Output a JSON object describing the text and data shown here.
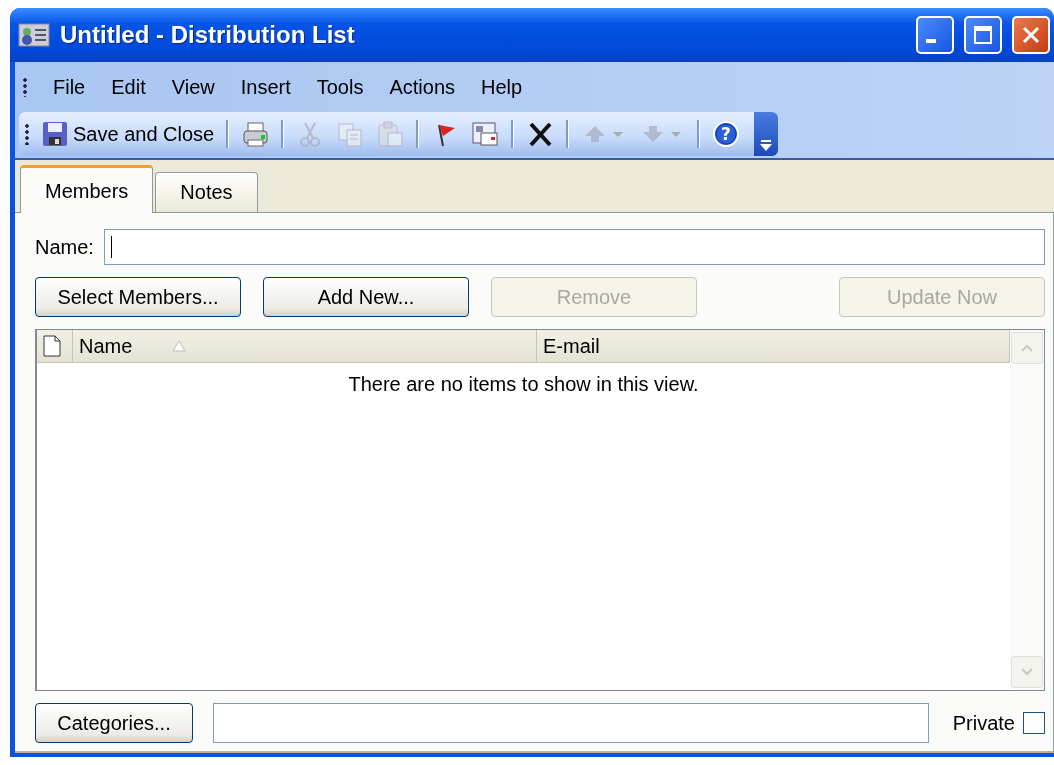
{
  "window": {
    "title": "Untitled - Distribution List"
  },
  "menu": [
    "File",
    "Edit",
    "View",
    "Insert",
    "Tools",
    "Actions",
    "Help"
  ],
  "toolbar": [
    {
      "kind": "save",
      "label": "Save and Close",
      "disabled": false
    },
    {
      "kind": "separator"
    },
    {
      "kind": "print",
      "disabled": false
    },
    {
      "kind": "separator"
    },
    {
      "kind": "cut",
      "disabled": true
    },
    {
      "kind": "copy",
      "disabled": true
    },
    {
      "kind": "paste",
      "disabled": true
    },
    {
      "kind": "separator"
    },
    {
      "kind": "flag",
      "disabled": false
    },
    {
      "kind": "address",
      "disabled": false
    },
    {
      "kind": "separator"
    },
    {
      "kind": "delete",
      "disabled": false
    },
    {
      "kind": "separator"
    },
    {
      "kind": "up",
      "disabled": true
    },
    {
      "kind": "down",
      "disabled": true
    },
    {
      "kind": "separator"
    },
    {
      "kind": "help",
      "glyph": "?",
      "disabled": false
    }
  ],
  "tabs": [
    {
      "label": "Members",
      "selected": true
    },
    {
      "label": "Notes",
      "selected": false
    }
  ],
  "name_field": {
    "label": "Name:"
  },
  "buttons": [
    {
      "label": "Select Members...",
      "disabled": false
    },
    {
      "label": "Add New...",
      "disabled": false
    },
    {
      "label": "Remove",
      "disabled": true
    },
    {
      "label": "Update Now",
      "disabled": true
    }
  ],
  "table": {
    "columns": [
      {
        "label": "Name",
        "sorted": true
      },
      {
        "label": "E-mail",
        "sorted": false
      }
    ],
    "empty_message": "There are no items to show in this view."
  },
  "footer": {
    "button": "Categories...",
    "private_label": "Private",
    "private_checked": false
  }
}
